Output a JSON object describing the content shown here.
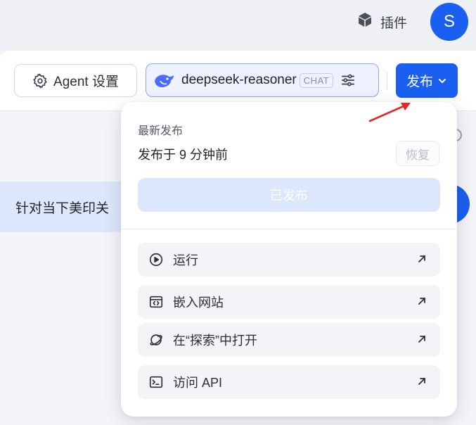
{
  "header": {
    "plugin_label": "插件",
    "avatar_initial": "S"
  },
  "toolbar": {
    "agent_settings_label": "Agent 设置",
    "model_name": "deepseek-reasoner",
    "model_tag": "CHAT",
    "publish_label": "发布"
  },
  "background": {
    "prompt_text": "针对当下美印关"
  },
  "publish_menu": {
    "heading": "最新发布",
    "published_time": "发布于 9 分钟前",
    "restore_label": "恢复",
    "published_label": "已发布",
    "items": [
      {
        "label": "运行",
        "icon": "play-circle-icon"
      },
      {
        "label": "嵌入网站",
        "icon": "embed-code-icon"
      },
      {
        "label": "在“探索”中打开",
        "icon": "explore-planet-icon"
      },
      {
        "label": "访问 API",
        "icon": "terminal-icon"
      }
    ]
  },
  "colors": {
    "accent": "#1a5ff0",
    "annotation_arrow": "#e02a2a"
  }
}
